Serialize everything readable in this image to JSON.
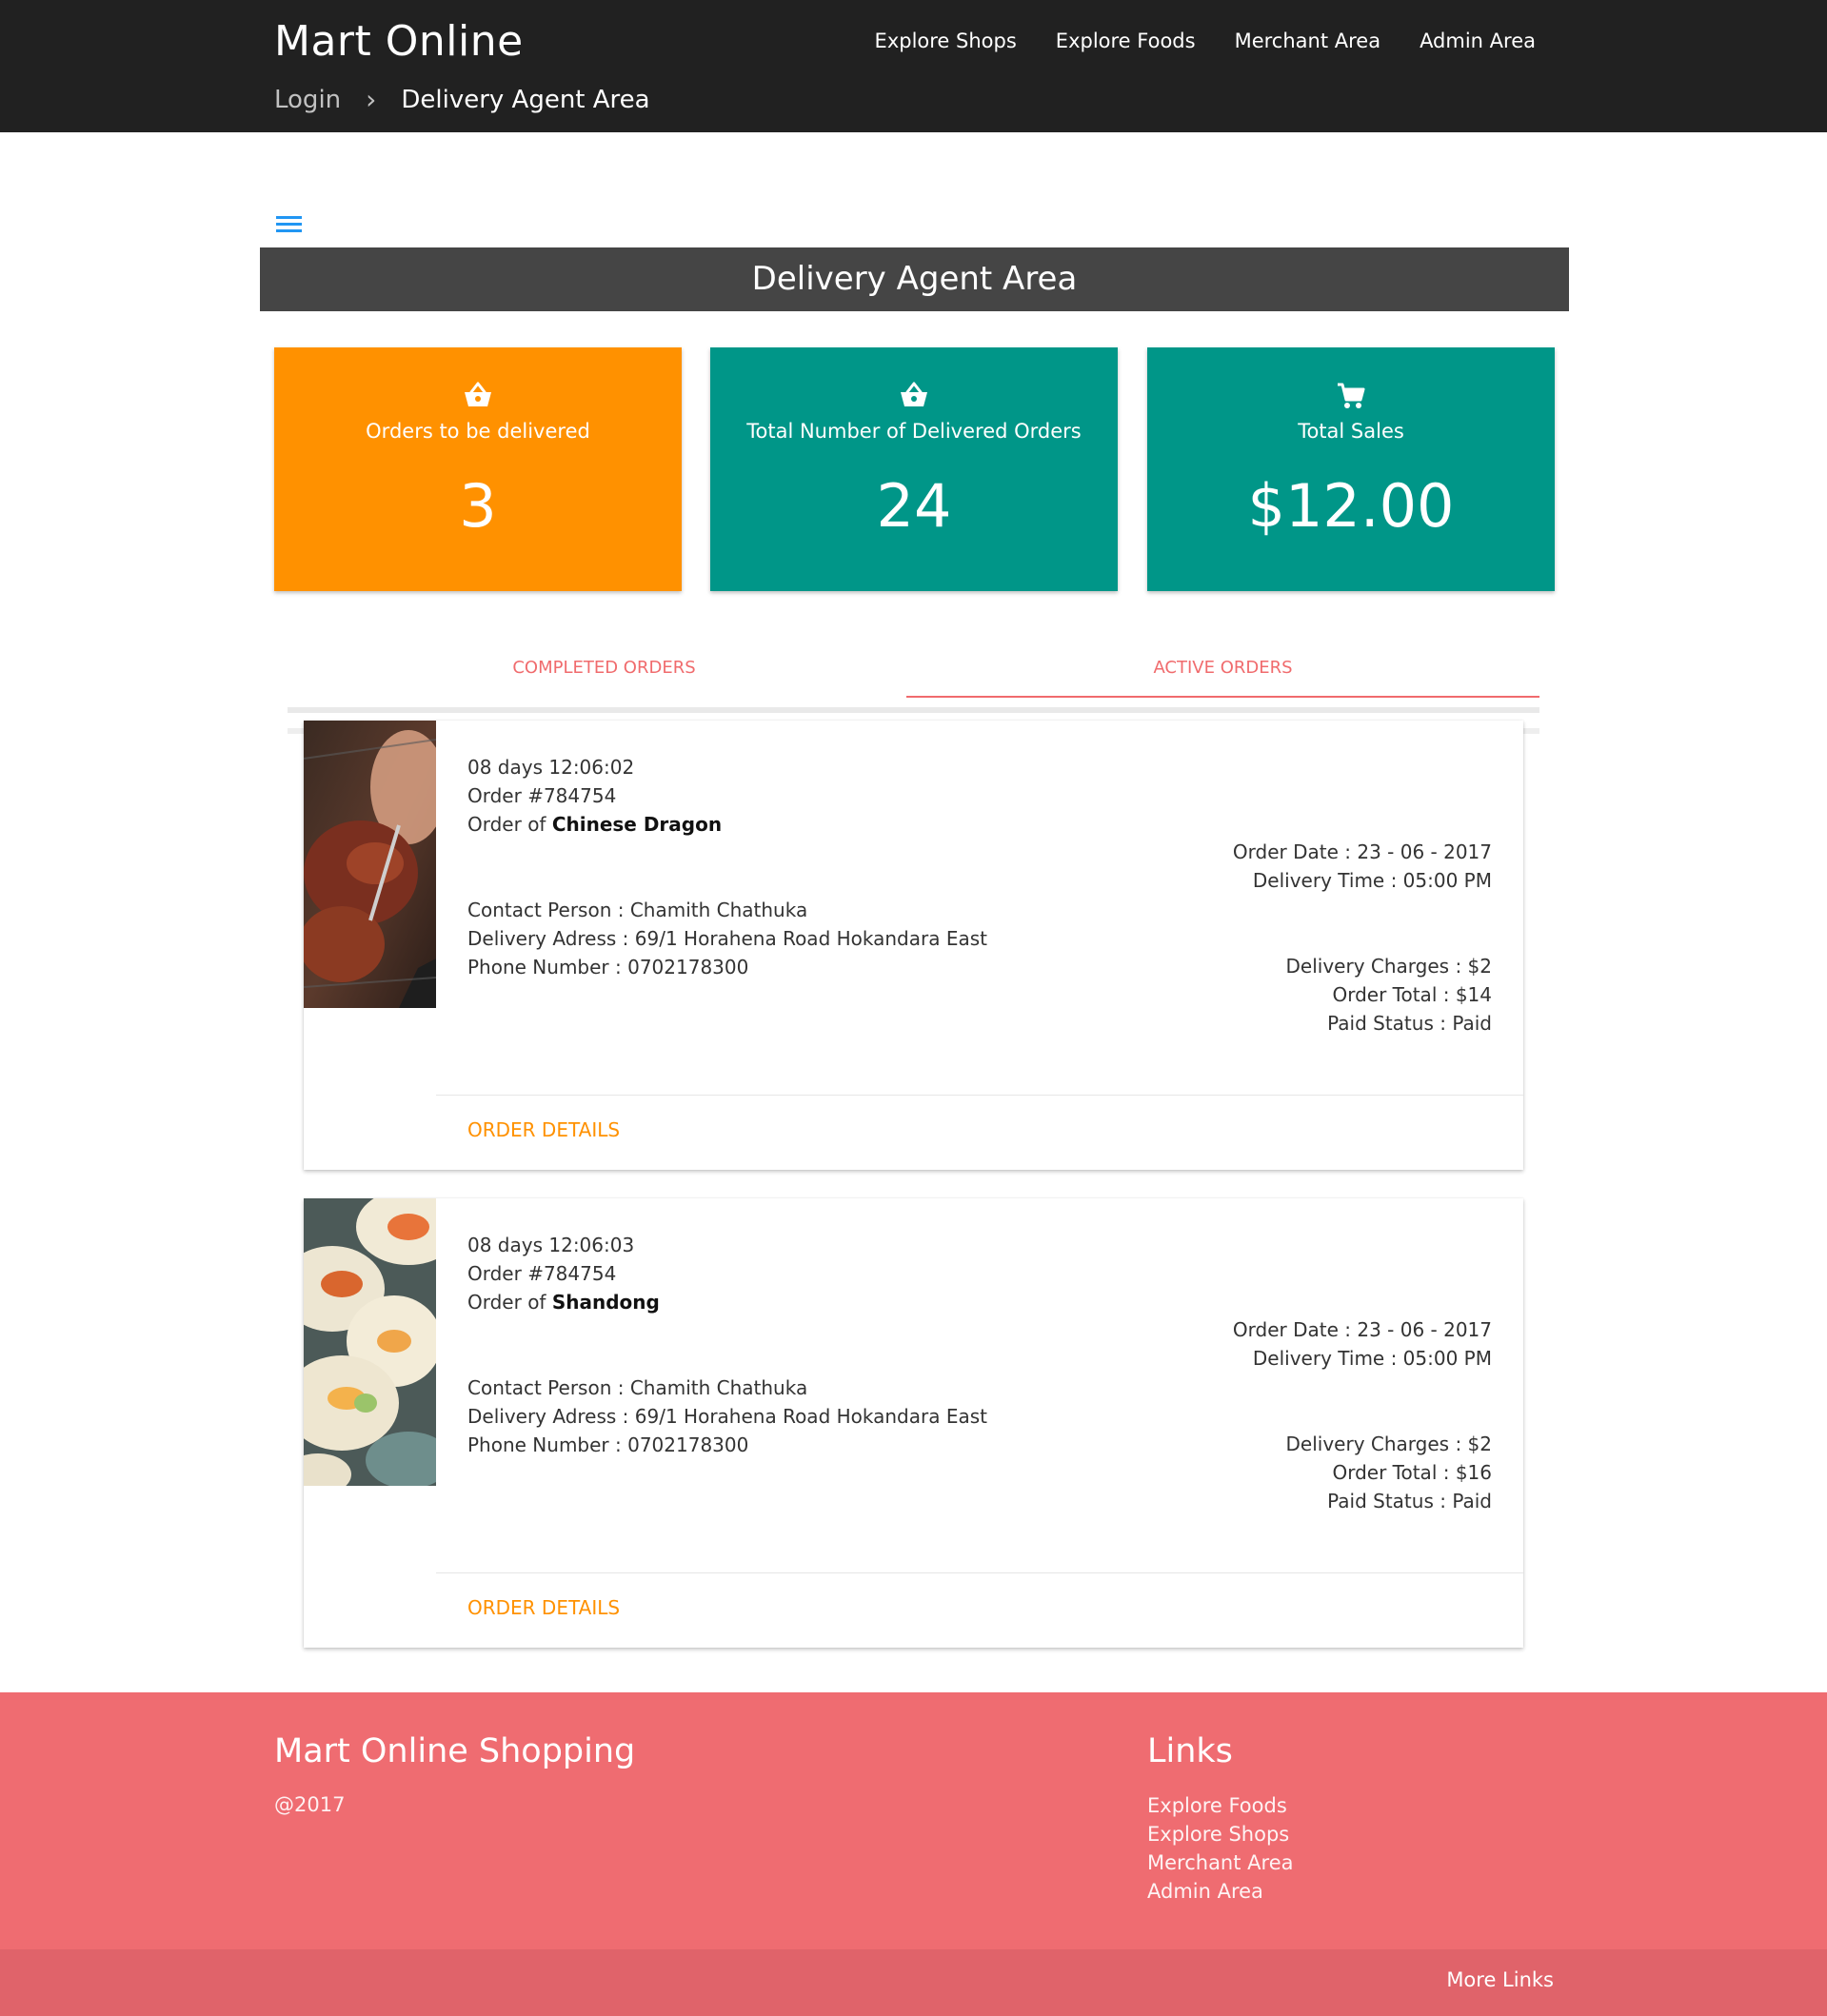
{
  "nav": {
    "brand": "Mart Online",
    "links": [
      "Explore Shops",
      "Explore Foods",
      "Merchant Area",
      "Admin Area"
    ],
    "breadcrumb": {
      "first": "Login",
      "current": "Delivery Agent Area"
    }
  },
  "page": {
    "title": "Delivery Agent Area",
    "menu_icon": "hamburger-menu-icon"
  },
  "stats": [
    {
      "icon": "basket-icon",
      "label": "Orders to be delivered",
      "value": "3",
      "color": "#ff9100"
    },
    {
      "icon": "basket-icon",
      "label": "Total Number of Delivered Orders",
      "value": "24",
      "color": "#009688"
    },
    {
      "icon": "cart-icon",
      "label": "Total Sales",
      "value": "$12.00",
      "color": "#009688"
    }
  ],
  "tabs": {
    "items": [
      "COMPLETED ORDERS",
      "ACTIVE ORDERS"
    ],
    "active": "ACTIVE ORDERS",
    "accent": "#f06b6d"
  },
  "orders": [
    {
      "timer": "08 days 12:06:02",
      "order_no": "Order #784754",
      "order_of_prefix": "Order of ",
      "shop": "Chinese Dragon",
      "contact": "Contact Person : Chamith Chathuka",
      "address": "Delivery Adress : 69/1 Horahena Road Hokandara East",
      "phone": "Phone Number : 0702178300",
      "order_date": "Order Date : 23 - 06 - 2017",
      "delivery_time": "Delivery Time : 05:00 PM",
      "delivery_charges": "Delivery Charges : $2",
      "order_total": "Order Total : $14",
      "paid_status": "Paid Status : Paid",
      "action": "ORDER DETAILS",
      "image": "grilled-meat-photo"
    },
    {
      "timer": "08 days 12:06:03",
      "order_no": "Order #784754",
      "order_of_prefix": "Order of ",
      "shop": "Shandong",
      "contact": "Contact Person : Chamith Chathuka",
      "address": "Delivery Adress : 69/1 Horahena Road Hokandara East",
      "phone": "Phone Number : 0702178300",
      "order_date": "Order Date : 23 - 06 - 2017",
      "delivery_time": "Delivery Time : 05:00 PM",
      "delivery_charges": "Delivery Charges : $2",
      "order_total": "Order Total : $16",
      "paid_status": "Paid Status : Paid",
      "action": "ORDER DETAILS",
      "image": "sushi-rolls-photo"
    }
  ],
  "footer": {
    "title": "Mart Online Shopping",
    "copyright": "@2017",
    "links_title": "Links",
    "links": [
      "Explore Foods",
      "Explore Shops",
      "Merchant Area",
      "Admin Area"
    ],
    "more_links": "More Links",
    "color": "#ef6c71"
  }
}
